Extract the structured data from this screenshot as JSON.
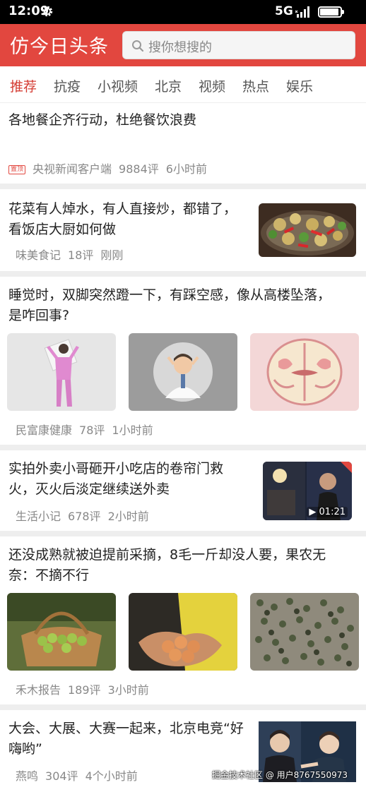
{
  "status_bar": {
    "time": "12:09",
    "network": "5G"
  },
  "header": {
    "title": "仿今日头条",
    "search_placeholder": "搜你想搜的"
  },
  "tabs": [
    {
      "label": "推荐",
      "active": true
    },
    {
      "label": "抗疫"
    },
    {
      "label": "小视频"
    },
    {
      "label": "北京"
    },
    {
      "label": "视频"
    },
    {
      "label": "热点"
    },
    {
      "label": "娱乐"
    }
  ],
  "feed": [
    {
      "title": "各地餐企齐行动，杜绝餐饮浪费",
      "badge": "置顶",
      "source": "央视新闻客户端",
      "comments": "9884评",
      "time": "6小时前"
    },
    {
      "title_line1": "花菜有人焯水，有人直接炒，都错了，",
      "title_line2": "看饭店大厨如何做",
      "source": "味美食记",
      "comments": "18评",
      "time": "刚刚"
    },
    {
      "title_line1": "睡觉时，双脚突然蹬一下，有踩空感，像从高楼坠落，",
      "title_line2": "是咋回事?",
      "source": "民富康健康",
      "comments": "78评",
      "time": "1小时前"
    },
    {
      "title_line1": "实拍外卖小哥砸开小吃店的卷帘门救",
      "title_line2": "火，灭火后淡定继续送外卖",
      "source": "生活小记",
      "comments": "678评",
      "time": "2小时前",
      "duration": "01:21"
    },
    {
      "title_line1": "还没成熟就被迫提前采摘，8毛一斤却没人要，果农无",
      "title_line2": "奈：不摘不行",
      "source": "禾木报告",
      "comments": "189评",
      "time": "3小时前"
    },
    {
      "title_line1": "大会、大展、大赛一起来，北京电竞“好",
      "title_line2": "嗨哟”",
      "source": "燕鸣",
      "comments": "304评",
      "time": "4个小时前"
    }
  ],
  "watermark": "掘金技术社区 @ 用户8767550973",
  "colors": {
    "brand_red": "#e2473f",
    "active_tab": "#d43c33",
    "meta_gray": "#888888",
    "separator": "#eeeeee"
  }
}
